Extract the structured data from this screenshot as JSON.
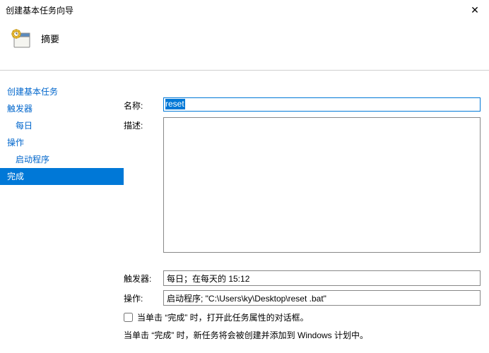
{
  "window": {
    "title": "创建基本任务向导",
    "close_glyph": "✕"
  },
  "header": {
    "heading": "摘要"
  },
  "sidebar": {
    "items": [
      {
        "label": "创建基本任务",
        "indent": false
      },
      {
        "label": "触发器",
        "indent": false
      },
      {
        "label": "每日",
        "indent": true
      },
      {
        "label": "操作",
        "indent": false
      },
      {
        "label": "启动程序",
        "indent": true
      },
      {
        "label": "完成",
        "indent": false,
        "selected": true
      }
    ]
  },
  "form": {
    "name_label": "名称:",
    "name_value": "reset",
    "desc_label": "描述:",
    "desc_value": "",
    "trigger_label": "触发器:",
    "trigger_value": "每日；在每天的 15:12",
    "action_label": "操作:",
    "action_value": "启动程序; \"C:\\Users\\ky\\Desktop\\reset .bat\"",
    "open_properties_label": "当单击 “完成” 时，打开此任务属性的对话框。",
    "info_line": "当单击 “完成” 时，新任务将会被创建并添加到 Windows 计划中。"
  }
}
